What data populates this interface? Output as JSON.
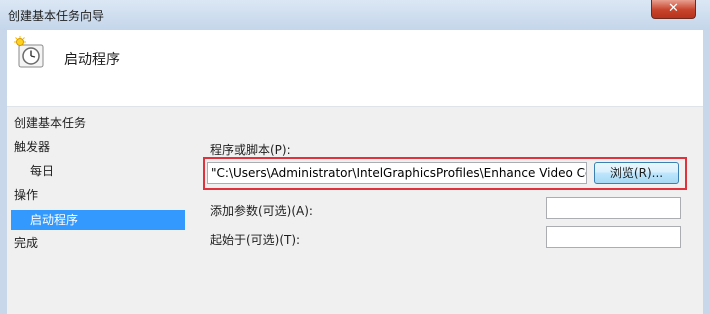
{
  "window": {
    "title": "创建基本任务向导",
    "close_label": "✕"
  },
  "header": {
    "title": "启动程序",
    "icon": "task-scheduler-clock-icon"
  },
  "sidebar": {
    "items": [
      {
        "label": "创建基本任务"
      },
      {
        "label": "触发器"
      },
      {
        "label": "每日"
      },
      {
        "label": "操作"
      },
      {
        "label": "启动程序"
      },
      {
        "label": "完成"
      }
    ],
    "selected": "启动程序"
  },
  "form": {
    "program_label": "程序或脚本(P):",
    "program_value": "\"C:\\Users\\Administrator\\IntelGraphicsProfiles\\Enhance Video Co",
    "browse_label": "浏览(R)...",
    "args_label": "添加参数(可选)(A):",
    "args_value": "",
    "start_in_label": "起始于(可选)(T):",
    "start_in_value": ""
  },
  "colors": {
    "selection": "#3399ff",
    "annotation": "#e0313c",
    "close_button": "#c7432b"
  }
}
